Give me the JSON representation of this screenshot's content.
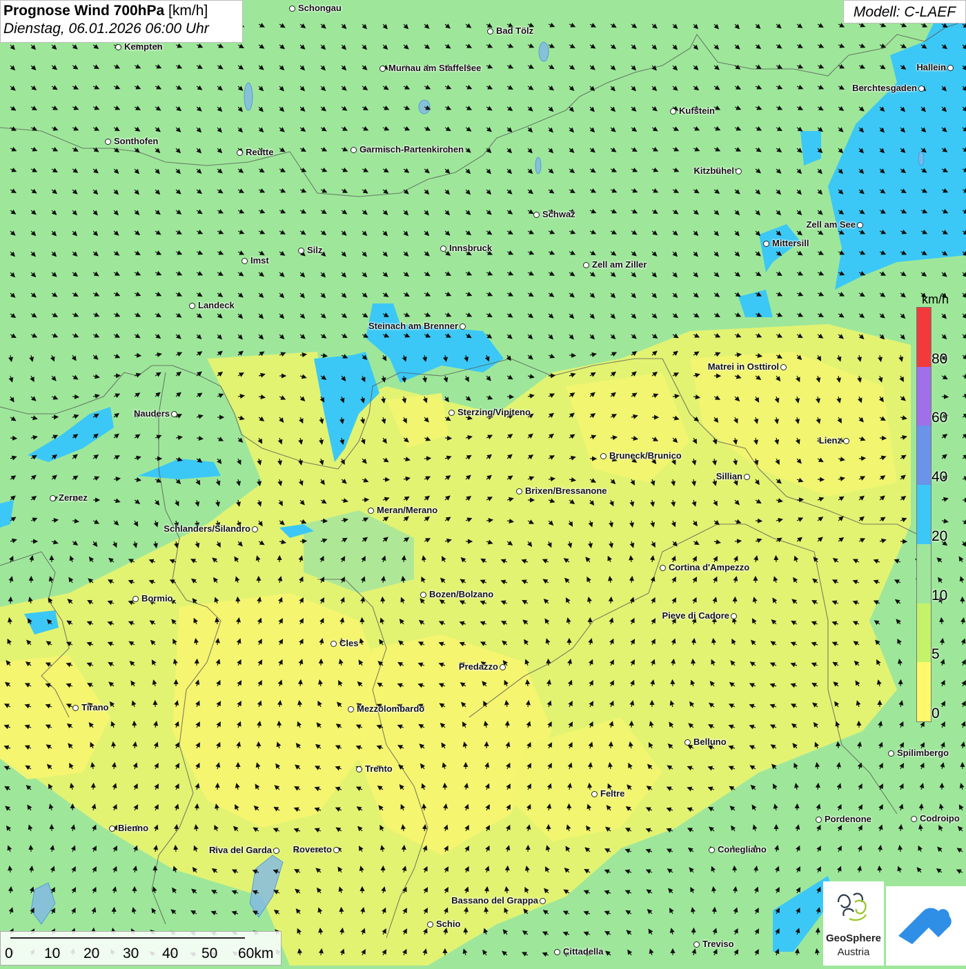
{
  "header": {
    "title_bold": "Prognose Wind 700hPa",
    "title_unit": "[km/h]",
    "datetime": "Dienstag, 06.01.2026 06:00 Uhr",
    "model": "Modell: C-LAEF"
  },
  "legend": {
    "unit": "km/h",
    "classes": [
      {
        "from": 0,
        "to": 5,
        "color": "#fdf96a"
      },
      {
        "from": 5,
        "to": 10,
        "color": "#c4f36a"
      },
      {
        "from": 10,
        "to": 20,
        "color": "#9ee79a"
      },
      {
        "from": 20,
        "to": 40,
        "color": "#3cc8f6"
      },
      {
        "from": 40,
        "to": 60,
        "color": "#6a93ea"
      },
      {
        "from": 60,
        "to": 80,
        "color": "#9f70ea"
      },
      {
        "from": 80,
        "to": 100,
        "color": "#f23a3a"
      }
    ],
    "tick_labels": [
      "0",
      "5",
      "10",
      "20",
      "40",
      "60",
      "80"
    ]
  },
  "scale_bar": {
    "labels": [
      "0",
      "10",
      "20",
      "30",
      "40",
      "50"
    ],
    "last_label": "60km"
  },
  "cities": [
    {
      "name": "Schongau",
      "label_side": "right"
    },
    {
      "name": "Bad Tölz",
      "label_side": "right"
    },
    {
      "name": "Kempten",
      "label_side": "right"
    },
    {
      "name": "Murnau am Staffelsee",
      "label_side": "right"
    },
    {
      "name": "Hallein",
      "label_side": "left"
    },
    {
      "name": "Berchtesgaden",
      "label_side": "left"
    },
    {
      "name": "Kufstein",
      "label_side": "right"
    },
    {
      "name": "Sonthofen",
      "label_side": "right"
    },
    {
      "name": "Reutte",
      "label_side": "right"
    },
    {
      "name": "Garmisch-Partenkirchen",
      "label_side": "right"
    },
    {
      "name": "Kitzbühel",
      "label_side": "left"
    },
    {
      "name": "Schwaz",
      "label_side": "right"
    },
    {
      "name": "Zell am See",
      "label_side": "left"
    },
    {
      "name": "Mittersill",
      "label_side": "right"
    },
    {
      "name": "Innsbruck",
      "label_side": "right"
    },
    {
      "name": "Silz",
      "label_side": "right"
    },
    {
      "name": "Imst",
      "label_side": "right"
    },
    {
      "name": "Zell am Ziller",
      "label_side": "right"
    },
    {
      "name": "Landeck",
      "label_side": "right"
    },
    {
      "name": "Steinach am Brenner",
      "label_side": "left"
    },
    {
      "name": "Matrei in Osttirol",
      "label_side": "left"
    },
    {
      "name": "Nauders",
      "label_side": "left"
    },
    {
      "name": "Sterzing/Vipiteno",
      "label_side": "right"
    },
    {
      "name": "Lienz",
      "label_side": "left"
    },
    {
      "name": "Bruneck/Brunico",
      "label_side": "right"
    },
    {
      "name": "Sillian",
      "label_side": "left"
    },
    {
      "name": "Brixen/Bressanone",
      "label_side": "right"
    },
    {
      "name": "Zernez",
      "label_side": "right"
    },
    {
      "name": "Meran/Merano",
      "label_side": "right"
    },
    {
      "name": "Schlanders/Silandro",
      "label_side": "left"
    },
    {
      "name": "Cortina d'Ampezzo",
      "label_side": "right"
    },
    {
      "name": "Bozen/Bolzano",
      "label_side": "right"
    },
    {
      "name": "Bormio",
      "label_side": "right"
    },
    {
      "name": "Pieve di Cadore",
      "label_side": "left"
    },
    {
      "name": "Cles",
      "label_side": "right"
    },
    {
      "name": "Predazzo",
      "label_side": "left"
    },
    {
      "name": "Tirano",
      "label_side": "right"
    },
    {
      "name": "Mezzolombardo",
      "label_side": "right"
    },
    {
      "name": "Belluno",
      "label_side": "right"
    },
    {
      "name": "Spilimbergo",
      "label_side": "right"
    },
    {
      "name": "Trento",
      "label_side": "right"
    },
    {
      "name": "Feltre",
      "label_side": "right"
    },
    {
      "name": "Pordenone",
      "label_side": "right"
    },
    {
      "name": "Codroipo",
      "label_side": "right"
    },
    {
      "name": "Bienno",
      "label_side": "right"
    },
    {
      "name": "Riva del Garda",
      "label_side": "left"
    },
    {
      "name": "Rovereto",
      "label_side": "left"
    },
    {
      "name": "Conegliano",
      "label_side": "right"
    },
    {
      "name": "Bassano del Grappa",
      "label_side": "left"
    },
    {
      "name": "Schio",
      "label_side": "right"
    },
    {
      "name": "Treviso",
      "label_side": "right"
    },
    {
      "name": "Cittadella",
      "label_side": "right"
    }
  ],
  "logos": {
    "geosphere_name": "GeoSphere",
    "geosphere_sub": "Austria"
  }
}
